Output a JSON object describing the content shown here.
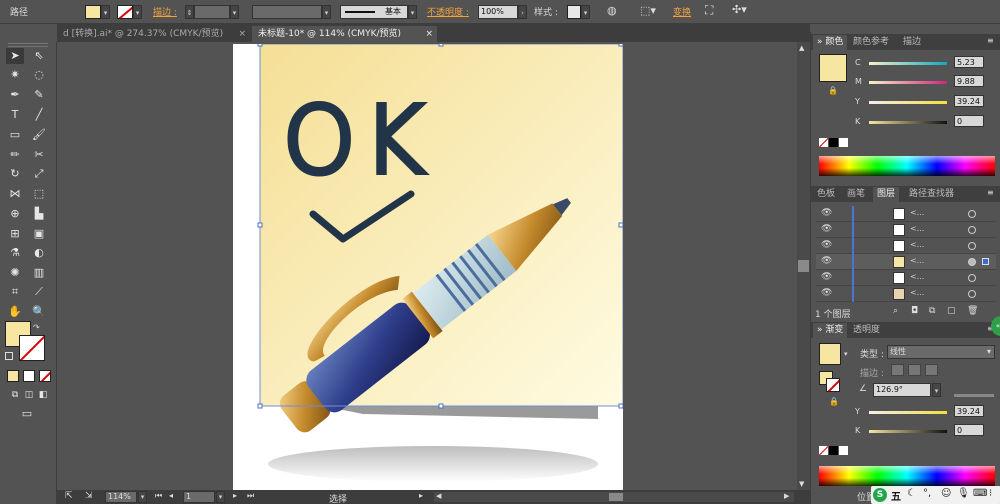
{
  "control_bar": {
    "path_label": "路径",
    "stroke_label": "描边 :",
    "stroke_style": "基本",
    "opacity_label": "不透明度 :",
    "opacity_value": "100%",
    "style_label": "样式 :",
    "transform_label": "变换"
  },
  "tabs": [
    {
      "label": "d [转换].ai* @ 274.37% (CMYK/预览)",
      "close": "×"
    },
    {
      "label": "未标题-10* @ 114% (CMYK/预览)",
      "close": "×"
    }
  ],
  "color_panel": {
    "tabs": [
      "颜色",
      "颜色参考",
      "描边"
    ],
    "c_label": "C",
    "m_label": "M",
    "y_label": "Y",
    "k_label": "K",
    "c_value": "5.23",
    "m_value": "9.88",
    "y_value": "39.24",
    "k_value": "0",
    "fill_color": "#f6e6a1"
  },
  "layers_panel": {
    "tabs": [
      "色板",
      "画笔",
      "图层",
      "路径查找器"
    ],
    "footer": "1 个图层",
    "rows": [
      {
        "name": "<...",
        "thumb": "#ffffff"
      },
      {
        "name": "<...",
        "thumb": "#ffffff"
      },
      {
        "name": "<...",
        "thumb": "#ffffff"
      },
      {
        "name": "<...",
        "thumb": "#f6e6a1"
      },
      {
        "name": "<...",
        "thumb": "#ffffff"
      },
      {
        "name": "<...",
        "thumb": "#e8d2b0"
      }
    ]
  },
  "gradient_panel": {
    "tabs": [
      "渐变",
      "透明度"
    ],
    "type_label": "类型 :",
    "type_value": "线性",
    "stroke_label": "描边 :",
    "angle_value": "126.9°",
    "y_label": "Y",
    "k_label": "K",
    "y_value": "39.24",
    "k_value": "0",
    "location_label": "位置"
  },
  "status_bar": {
    "zoom": "114%",
    "page": "1",
    "tool": "选择"
  },
  "artwork": {
    "text": "OK",
    "note_color": "#f7e8a4",
    "ink_color": "#223548"
  },
  "tray": {
    "ime_label": "五",
    "logo": "S"
  }
}
